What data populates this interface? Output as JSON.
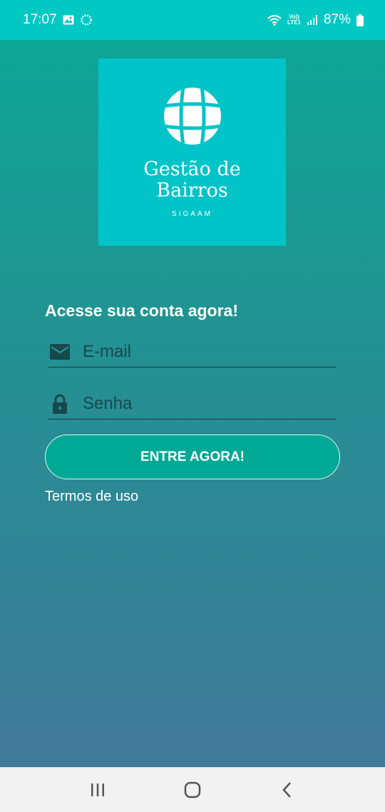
{
  "status_bar": {
    "time": "17:07",
    "battery": "87%",
    "lte_top": "Vo))",
    "lte_bottom": "LTE1",
    "icons": [
      "image-icon",
      "sync-icon",
      "wifi-icon",
      "volte-icon",
      "signal-icon",
      "battery-icon"
    ]
  },
  "logo": {
    "title": "Gestão de Bairros",
    "subtitle": "SIGAAM",
    "icon": "globe-icon",
    "background": "#00c4c8"
  },
  "form": {
    "heading": "Acesse sua conta agora!",
    "email": {
      "placeholder": "E-mail",
      "value": "",
      "icon": "mail-icon"
    },
    "password": {
      "placeholder": "Senha",
      "value": "",
      "icon": "lock-icon"
    },
    "submit_label": "ENTRE AGORA!",
    "terms_label": "Termos de uso"
  },
  "nav": {
    "icons": [
      "recent-apps-icon",
      "home-icon",
      "back-icon"
    ]
  },
  "colors": {
    "status_bar": "#00c8c3",
    "gradient_top": "#0aa897",
    "gradient_bottom": "#46779b",
    "button": "#00a995",
    "nav_bar": "#f2f2f2"
  }
}
